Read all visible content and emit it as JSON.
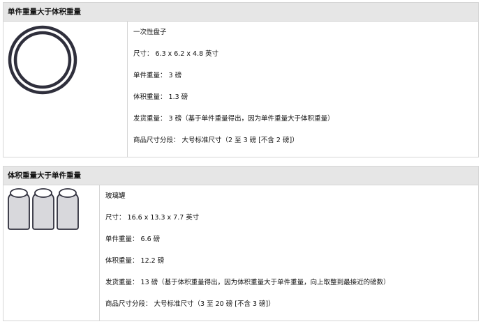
{
  "sections": [
    {
      "heading": "单件重量大于体积重量",
      "icon": "plate-icon",
      "lines": [
        "一次性盘子",
        "尺寸： 6.3 x 6.2 x 4.8 英寸",
        "单件重量： 3 磅",
        "体积重量： 1.3 磅",
        "发货重量： 3 磅（基于单件重量得出，因为单件重量大于体积重量）",
        "商品尺寸分段： 大号标准尺寸（2 至 3 磅 [不含 2 磅]）"
      ]
    },
    {
      "heading": "体积重量大于单件重量",
      "icon": "glass-jars-icon",
      "lines": [
        "玻璃罐",
        "尺寸： 16.6 x 13.3 x 7.7 英寸",
        "单件重量： 6.6 磅",
        "体积重量： 12.2 磅",
        "发货重量： 13 磅（基于体积重量得出，因为体积重量大于单件重量，向上取整到最接近的磅数）",
        "商品尺寸分段： 大号标准尺寸（3 至 20 磅 [不含 3 磅]）"
      ]
    }
  ]
}
